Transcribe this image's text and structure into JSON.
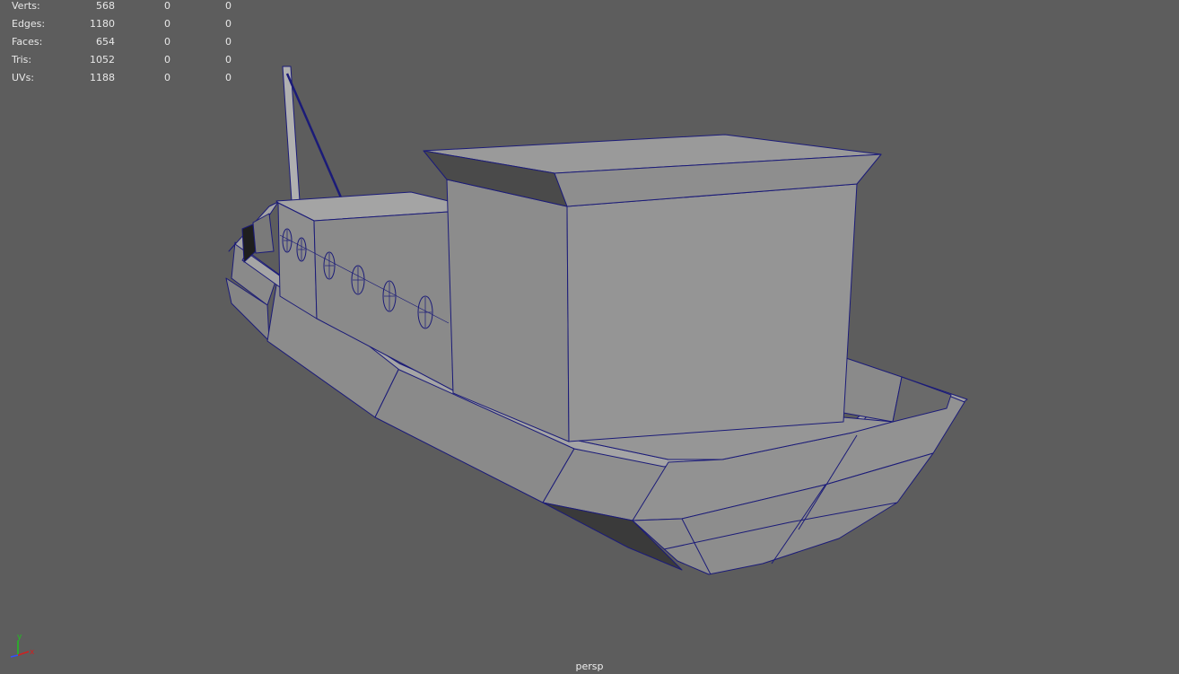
{
  "stats": [
    {
      "label": "Verts:",
      "total": "568",
      "selected": "0",
      "highlighted": "0"
    },
    {
      "label": "Edges:",
      "total": "1180",
      "selected": "0",
      "highlighted": "0"
    },
    {
      "label": "Faces:",
      "total": "654",
      "selected": "0",
      "highlighted": "0"
    },
    {
      "label": "Tris:",
      "total": "1052",
      "selected": "0",
      "highlighted": "0"
    },
    {
      "label": "UVs:",
      "total": "1188",
      "selected": "0",
      "highlighted": "0"
    }
  ],
  "camera": "persp",
  "axes": {
    "x": "x",
    "y": "y",
    "z": "z"
  },
  "colors": {
    "background": "#5d5d5d",
    "wireframe": "#1b1b78",
    "hud_text": "#e8e8e8",
    "axis_x": "#d02020",
    "axis_y": "#20c020",
    "axis_z": "#3050ff"
  },
  "model": "boat-mesh"
}
